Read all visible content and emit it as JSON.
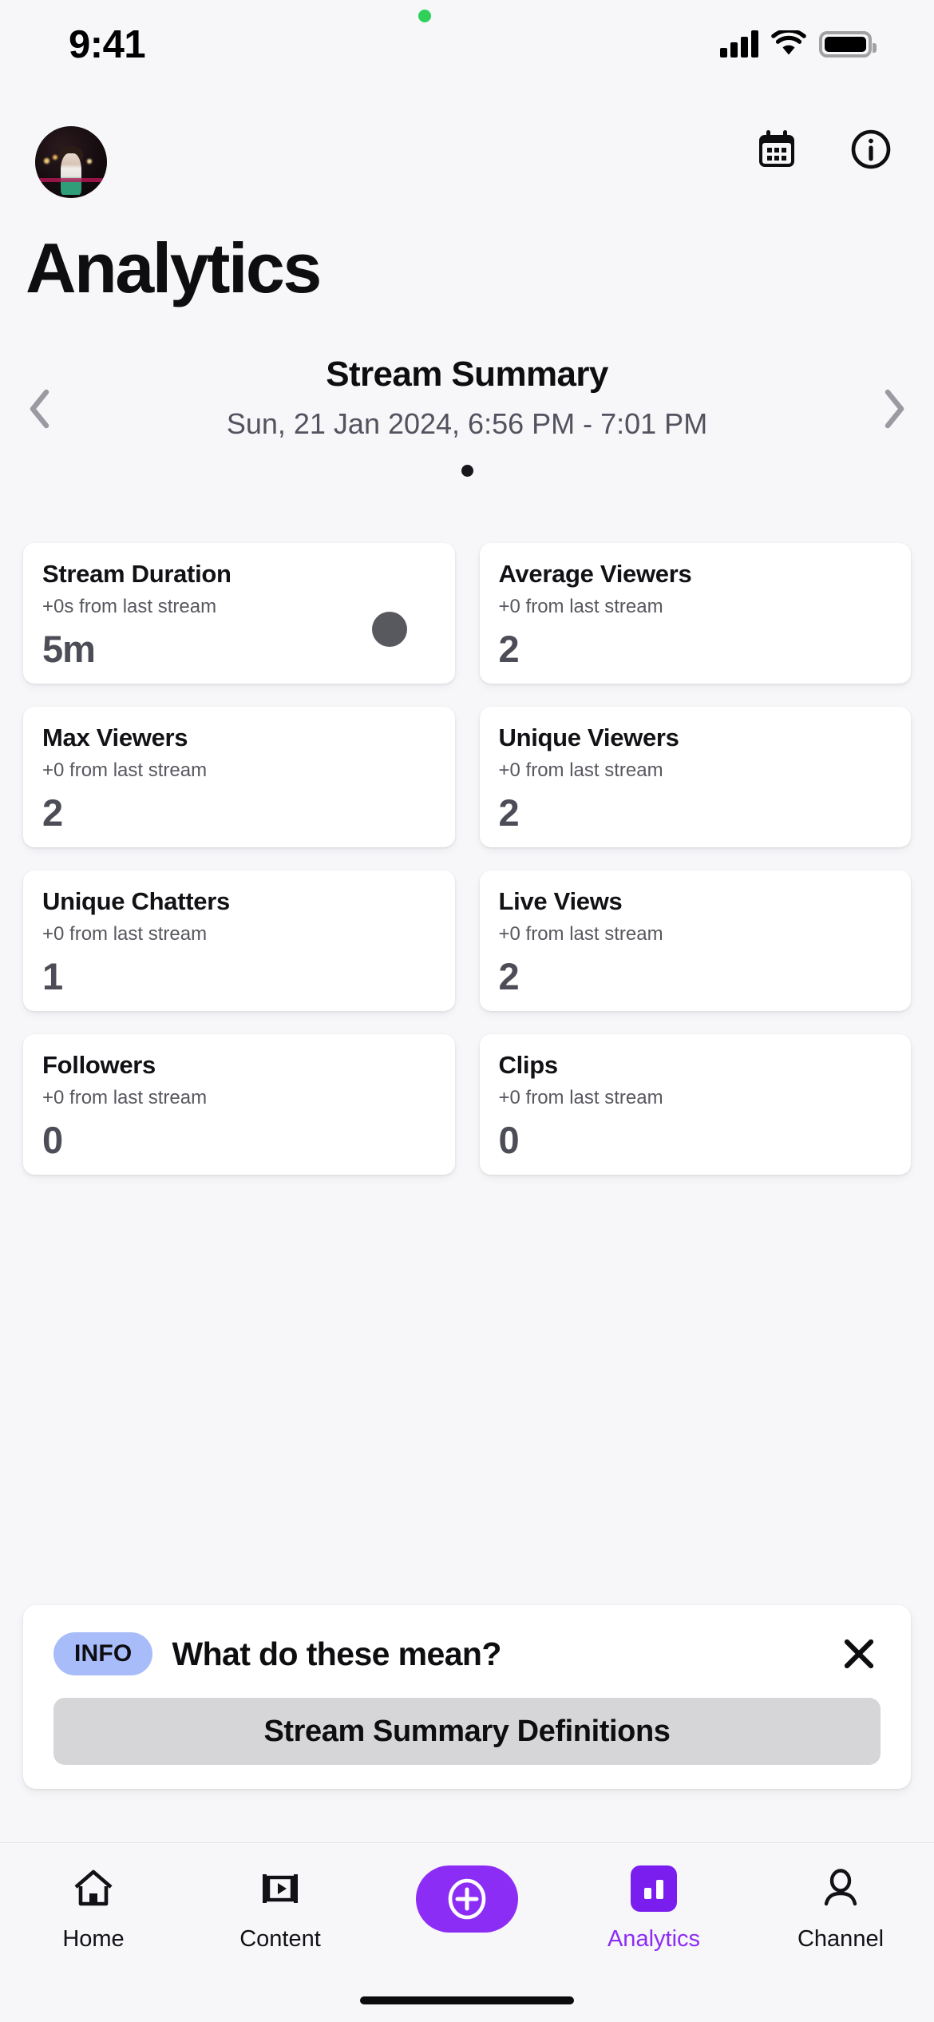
{
  "status_bar": {
    "time": "9:41",
    "icons": [
      "cellular-signal",
      "wifi",
      "battery",
      "recording-dot"
    ]
  },
  "header": {
    "avatar_label": "Profile",
    "calendar_icon": "calendar-icon",
    "info_icon": "info-circle-icon"
  },
  "page": {
    "title": "Analytics"
  },
  "summary": {
    "title": "Stream Summary",
    "date_range": "Sun, 21 Jan 2024, 6:56 PM - 7:01 PM",
    "prev_icon": "chevron-left-icon",
    "next_icon": "chevron-right-icon",
    "page_dots": 1,
    "active_dot": 0
  },
  "stats": [
    {
      "title": "Stream Duration",
      "delta": "+0s from last stream",
      "value": "5m"
    },
    {
      "title": "Average Viewers",
      "delta": "+0 from last stream",
      "value": "2"
    },
    {
      "title": "Max Viewers",
      "delta": "+0 from last stream",
      "value": "2"
    },
    {
      "title": "Unique Viewers",
      "delta": "+0 from last stream",
      "value": "2"
    },
    {
      "title": "Unique Chatters",
      "delta": "+0 from last stream",
      "value": "1"
    },
    {
      "title": "Live Views",
      "delta": "+0 from last stream",
      "value": "2"
    },
    {
      "title": "Followers",
      "delta": "+0 from last stream",
      "value": "0"
    },
    {
      "title": "Clips",
      "delta": "+0 from last stream",
      "value": "0"
    }
  ],
  "info_banner": {
    "badge": "INFO",
    "question": "What do these mean?",
    "close_icon": "close-icon",
    "definitions_button": "Stream Summary Definitions"
  },
  "tabbar": [
    {
      "label": "Home",
      "icon": "home-icon",
      "active": false
    },
    {
      "label": "Content",
      "icon": "video-clip-icon",
      "active": false
    },
    {
      "label": "",
      "icon": "plus-circle-icon",
      "active": false
    },
    {
      "label": "Analytics",
      "icon": "bar-chart-icon",
      "active": true
    },
    {
      "label": "Channel",
      "icon": "person-icon",
      "active": false
    }
  ],
  "colors": {
    "background": "#f7f6f9",
    "card": "#ffffff",
    "accent_purple": "#8c2df5",
    "accent_purple_dark": "#7a1ef0",
    "badge_blue": "#a7bcf9",
    "button_gray": "#d6d6d9",
    "value_gray": "#4d4d57",
    "muted_text": "#57575f",
    "recording_green": "#30d158"
  }
}
